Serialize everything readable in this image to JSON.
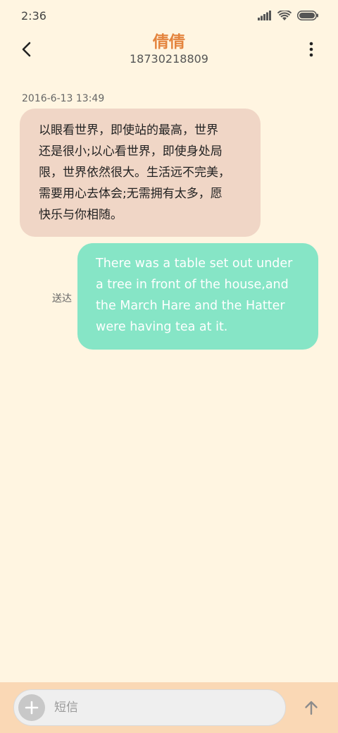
{
  "status_bar": {
    "time": "2:36",
    "icons": [
      "signal-icon",
      "wifi-icon",
      "battery-icon"
    ]
  },
  "header": {
    "contact_name": "倩倩",
    "contact_number": "18730218809",
    "icons": [
      "back-arrow-icon",
      "more-vertical-icon"
    ]
  },
  "conversation": {
    "timestamp": "2016-6-13 13:49",
    "messages": [
      {
        "direction": "incoming",
        "lines": [
          "以眼看世界，即使站的最高，世界",
          "还是很小;以心看世界，即使身处局",
          "限，世界依然很大。生活远不完美，",
          "需要用心去体会;无需拥有太多，愿",
          "快乐与你相随。"
        ]
      },
      {
        "direction": "outgoing",
        "status": "送达",
        "lines": [
          "There was a table set out under",
          "a tree in front of the house,and",
          "the March Hare and the Hatter",
          "were having tea at it."
        ]
      }
    ]
  },
  "composer": {
    "placeholder": "短信",
    "icons": [
      "plus-icon",
      "send-arrow-icon"
    ]
  },
  "colors": {
    "background": "#FFF5E1",
    "accent_name": "#E4843E",
    "incoming_bubble": "#F0D6C6",
    "outgoing_bubble": "#86E5C6",
    "input_bar": "#FAD8B5"
  }
}
